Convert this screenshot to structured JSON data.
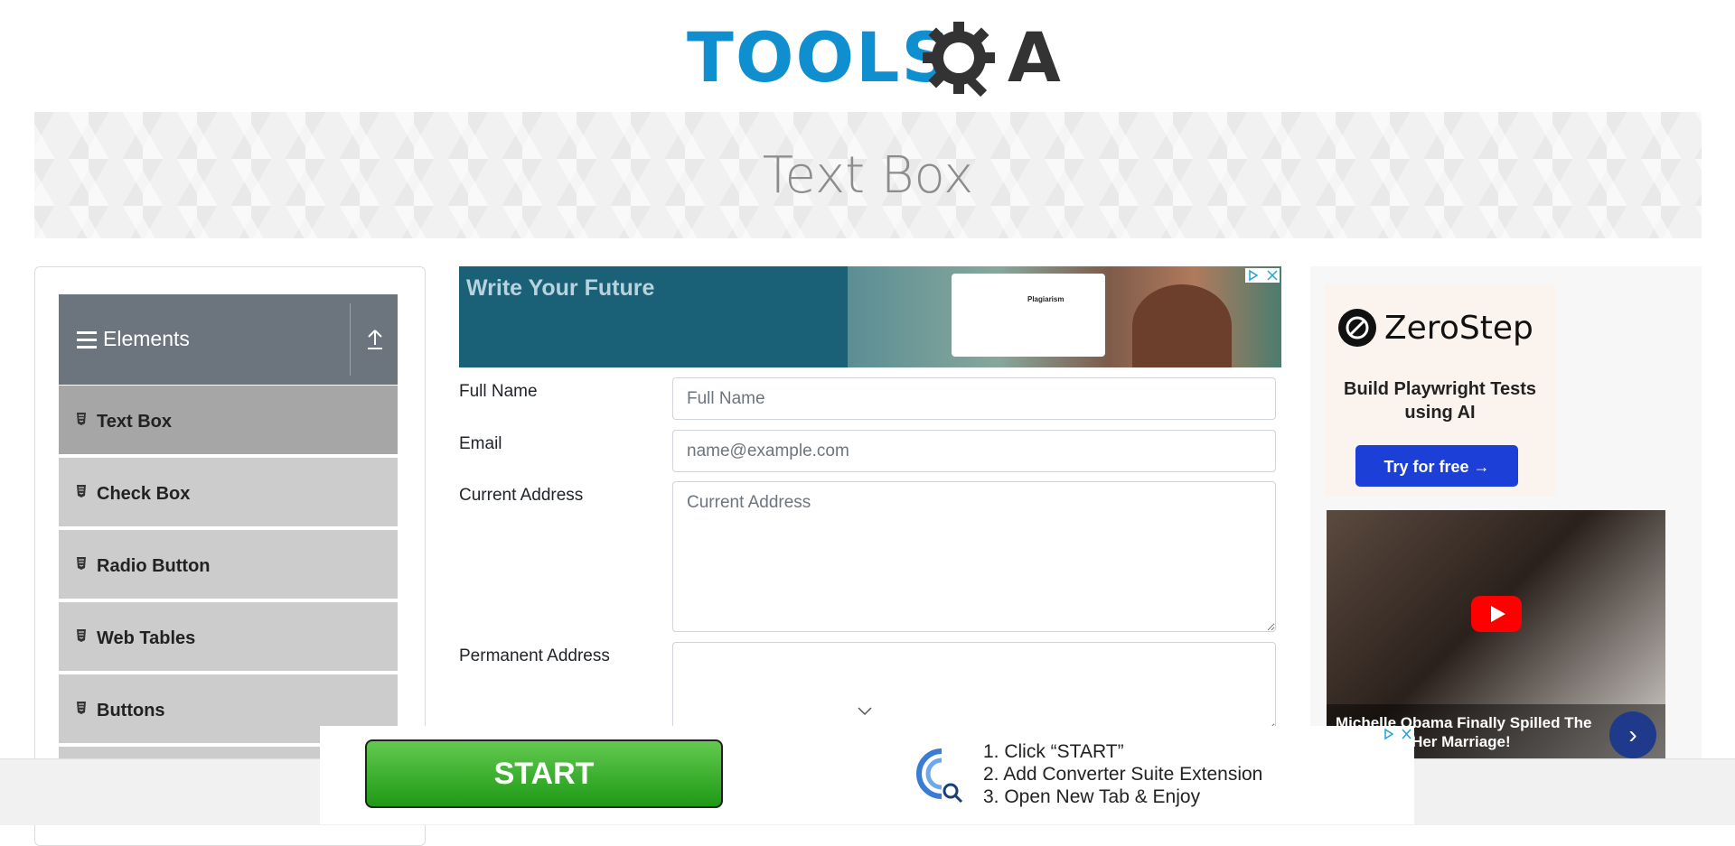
{
  "logo": {
    "text": "TOOLS",
    "text_after": "A"
  },
  "banner": {
    "title": "Text Box"
  },
  "sidebar": {
    "group": {
      "label": "Elements"
    },
    "items": [
      {
        "label": "Text Box",
        "active": true
      },
      {
        "label": "Check Box"
      },
      {
        "label": "Radio Button"
      },
      {
        "label": "Web Tables"
      },
      {
        "label": "Buttons"
      }
    ]
  },
  "top_ad": {
    "headline": "Write Your Future",
    "card_heading": "Plagiarism"
  },
  "form": {
    "full_name": {
      "label": "Full Name",
      "placeholder": "Full Name",
      "value": ""
    },
    "email": {
      "label": "Email",
      "placeholder": "name@example.com",
      "value": ""
    },
    "current_address": {
      "label": "Current Address",
      "placeholder": "Current Address",
      "value": ""
    },
    "permanent_address": {
      "label": "Permanent Address",
      "placeholder": "",
      "value": ""
    }
  },
  "right_ad": {
    "brand": "ZeroStep",
    "tagline": "Build Playwright Tests using AI",
    "cta": "Try for free →",
    "video_caption": "Michelle Obama Finally Spilled The Beans On Her Marriage!"
  },
  "bottom_ad": {
    "button": "START",
    "steps": [
      "1. Click “START”",
      "2. Add Converter Suite Extension",
      "3. Open New Tab & Enjoy"
    ]
  },
  "colors": {
    "brand_blue": "#0f8fd0",
    "group_header": "#6c757d",
    "menu_item": "#cccccc",
    "menu_item_active": "#a6a6a6",
    "cta_blue": "#1c3fd8",
    "start_green": "#1e9a16"
  },
  "icons": {
    "logo": "gear-magnifier-icon",
    "group": "hamburger-icon",
    "collapse": "upload-arrow-icon",
    "menu_item": "html5-icon",
    "video": "youtube-play-icon",
    "scroll": "chevron-down-icon"
  }
}
